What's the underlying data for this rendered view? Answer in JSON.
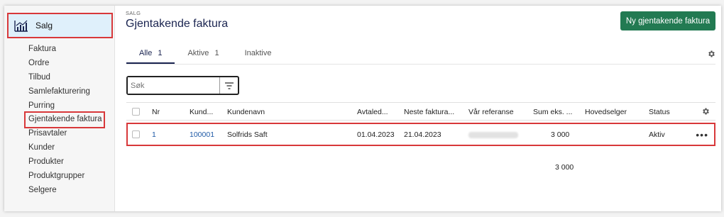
{
  "sidebar": {
    "section_label": "Salg",
    "items": [
      {
        "label": "Faktura"
      },
      {
        "label": "Ordre"
      },
      {
        "label": "Tilbud"
      },
      {
        "label": "Samlefakturering"
      },
      {
        "label": "Purring"
      },
      {
        "label": "Gjentakende faktura",
        "active": true
      },
      {
        "label": "Prisavtaler"
      },
      {
        "label": "Kunder"
      },
      {
        "label": "Produkter"
      },
      {
        "label": "Produktgrupper"
      },
      {
        "label": "Selgere"
      }
    ]
  },
  "header": {
    "breadcrumb": "SALG",
    "title": "Gjentakende faktura",
    "primary_button": "Ny gjentakende faktura"
  },
  "tabs": [
    {
      "label": "Alle",
      "count": "1",
      "active": true
    },
    {
      "label": "Aktive",
      "count": "1"
    },
    {
      "label": "Inaktive",
      "count": ""
    }
  ],
  "search": {
    "placeholder": "Søk",
    "value": ""
  },
  "table": {
    "columns": {
      "nr": "Nr",
      "kund": "Kund...",
      "kundenavn": "Kundenavn",
      "avtaled": "Avtaled...",
      "neste": "Neste faktura...",
      "var_ref": "Vår referanse",
      "sum": "Sum eks. ...",
      "hovedselger": "Hovedselger",
      "status": "Status"
    },
    "rows": [
      {
        "nr": "1",
        "kund": "100001",
        "kundenavn": "Solfrids Saft",
        "avtaled": "01.04.2023",
        "neste": "21.04.2023",
        "var_ref": "",
        "sum": "3 000",
        "hovedselger": "",
        "status": "Aktiv",
        "more": "•••"
      }
    ],
    "total": "3 000"
  },
  "colors": {
    "accent": "#1a2450",
    "primary_button": "#227a52",
    "highlight": "#d8383a",
    "link": "#1f5aa6",
    "sidebar_active_bg": "#dff0fb"
  },
  "icons": {
    "sidebar": "sales-chart-icon",
    "filter": "filter-icon",
    "settings": "gear-icon",
    "row_menu": "more-horizontal-icon"
  }
}
